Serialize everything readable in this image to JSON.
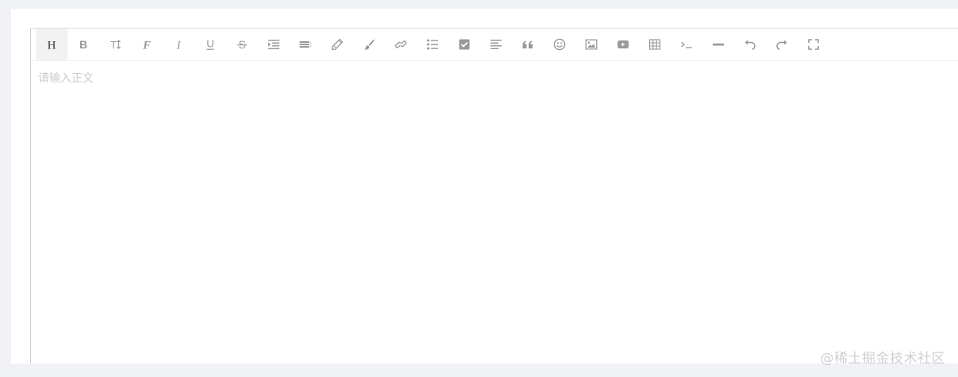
{
  "toolbar": {
    "buttons": [
      {
        "name": "header",
        "icon": "heading-icon",
        "active": true
      },
      {
        "name": "bold",
        "icon": "bold-icon"
      },
      {
        "name": "size",
        "icon": "font-size-icon"
      },
      {
        "name": "font-family",
        "icon": "font-family-icon"
      },
      {
        "name": "italic",
        "icon": "italic-icon"
      },
      {
        "name": "underline",
        "icon": "underline-icon"
      },
      {
        "name": "strikethrough",
        "icon": "strikethrough-icon"
      },
      {
        "name": "indent",
        "icon": "indent-icon"
      },
      {
        "name": "line-height",
        "icon": "line-height-icon"
      },
      {
        "name": "fore-color",
        "icon": "pencil-icon"
      },
      {
        "name": "back-color",
        "icon": "brush-icon"
      },
      {
        "name": "link",
        "icon": "link-icon"
      },
      {
        "name": "list",
        "icon": "list-icon"
      },
      {
        "name": "todo",
        "icon": "checkbox-icon"
      },
      {
        "name": "justify",
        "icon": "align-left-icon"
      },
      {
        "name": "quote",
        "icon": "quote-icon"
      },
      {
        "name": "emoticon",
        "icon": "smiley-icon"
      },
      {
        "name": "image",
        "icon": "image-icon"
      },
      {
        "name": "video",
        "icon": "video-icon"
      },
      {
        "name": "table",
        "icon": "table-icon"
      },
      {
        "name": "code",
        "icon": "terminal-icon"
      },
      {
        "name": "split-line",
        "icon": "horizontal-rule-icon"
      },
      {
        "name": "undo",
        "icon": "undo-icon"
      },
      {
        "name": "redo",
        "icon": "redo-icon"
      },
      {
        "name": "fullscreen",
        "icon": "fullscreen-icon"
      }
    ],
    "header_glyph": "H",
    "bold_glyph": "B",
    "size_glyph": "T",
    "font_glyph": "F",
    "italic_glyph": "I",
    "underline_glyph": "U",
    "strike_glyph": "S"
  },
  "editor": {
    "placeholder": "请输入正文"
  },
  "watermark": "@稀土掘金技术社区",
  "colors": {
    "icon": "#999999",
    "icon_active": "#333333",
    "placeholder": "#cccccc",
    "page_bg": "#f0f2f5"
  }
}
